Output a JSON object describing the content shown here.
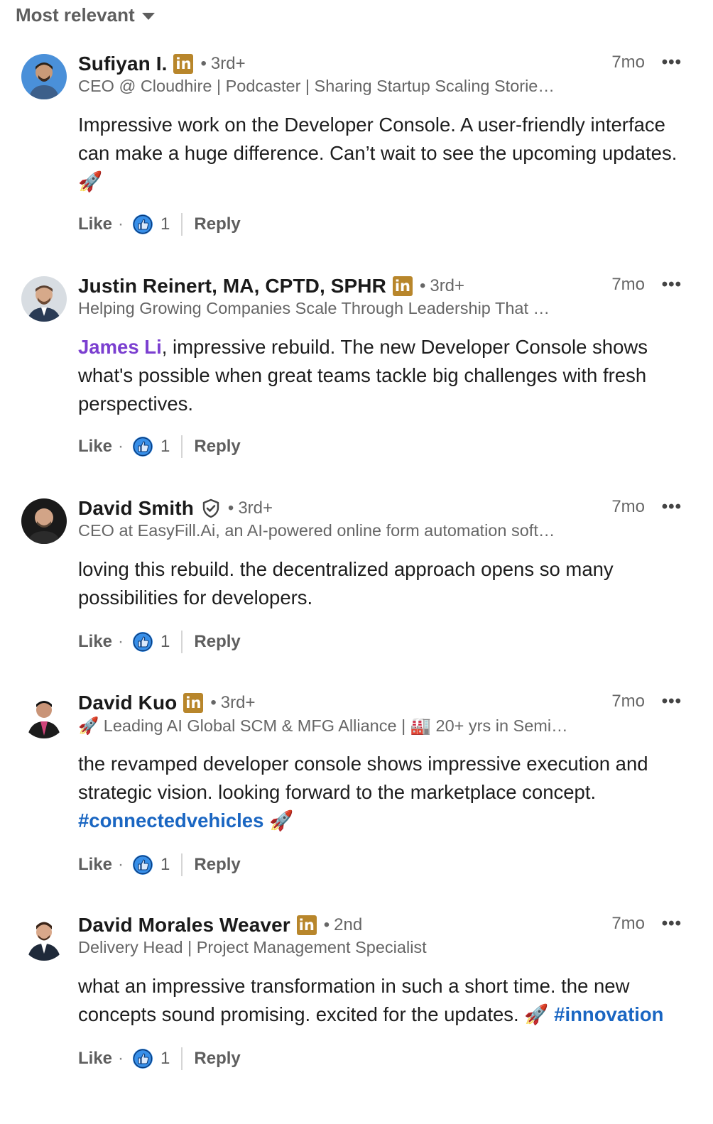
{
  "sort": {
    "label": "Most relevant"
  },
  "comments": [
    {
      "name": "Sufiyan I.",
      "has_li_badge": true,
      "degree": "3rd+",
      "time": "7mo",
      "headline": "CEO @ Cloudhire | Podcaster | Sharing Startup Scaling Storie…",
      "body_text": "Impressive work on the Developer Console. A user-friendly interface can make a huge difference. Can’t wait to see the upcoming updates. 🚀",
      "like_label": "Like",
      "reaction_count": "1",
      "reply_label": "Reply"
    },
    {
      "name": "Justin Reinert, MA, CPTD, SPHR",
      "has_li_badge": true,
      "degree": "3rd+",
      "time": "7mo",
      "headline": "Helping Growing Companies Scale Through Leadership That …",
      "mention": "James Li",
      "body_text": ", impressive rebuild. The new Developer Console shows what's possible when great teams tackle big challenges with fresh perspectives.",
      "like_label": "Like",
      "reaction_count": "1",
      "reply_label": "Reply"
    },
    {
      "name": "David Smith",
      "verified": true,
      "degree": "3rd+",
      "time": "7mo",
      "headline": "CEO at EasyFill.Ai, an AI-powered online form automation soft…",
      "body_text": "loving this rebuild. the decentralized approach opens so many possibilities for developers.",
      "like_label": "Like",
      "reaction_count": "1",
      "reply_label": "Reply"
    },
    {
      "name": "David Kuo",
      "has_li_badge": true,
      "degree": "3rd+",
      "time": "7mo",
      "headline": "🚀 Leading AI Global SCM & MFG Alliance | 🏭 20+ yrs in Semi…",
      "body_text": "the revamped developer console shows impressive execution and strategic vision. looking forward to the marketplace concept.",
      "hashtag": "#connectedvehicles",
      "body_suffix": " 🚀",
      "like_label": "Like",
      "reaction_count": "1",
      "reply_label": "Reply"
    },
    {
      "name": "David Morales Weaver",
      "has_li_badge": true,
      "degree": "2nd",
      "time": "7mo",
      "headline": "Delivery Head | Project Management Specialist",
      "body_text": "what an impressive transformation in such a short time. the new concepts sound promising. excited for the updates. 🚀",
      "hashtag": "#innovation",
      "like_label": "Like",
      "reaction_count": "1",
      "reply_label": "Reply"
    }
  ],
  "colors": {
    "li_badge": "#b8862b",
    "mention": "#7b3fd0",
    "hashtag": "#1a66c2",
    "reaction_blue": "#378fe9"
  }
}
